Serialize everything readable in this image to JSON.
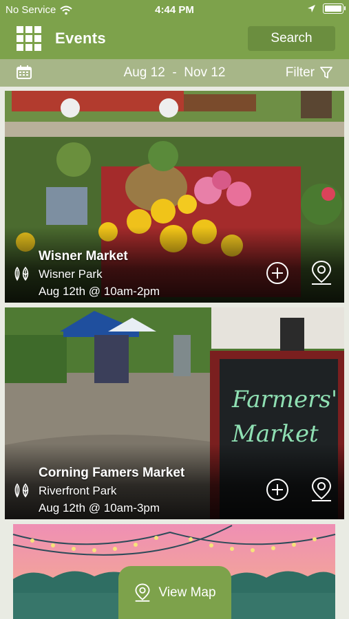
{
  "status_bar": {
    "carrier": "No Service",
    "time": "4:44 PM"
  },
  "header": {
    "title": "Events",
    "search_label": "Search"
  },
  "date_bar": {
    "range": "Aug 12  -  Nov 12",
    "filter_label": "Filter"
  },
  "events": [
    {
      "name": "Wisner Market",
      "venue": "Wisner Park",
      "time": "Aug 12th @ 10am-2pm"
    },
    {
      "name": "Corning Famers Market",
      "venue": "Riverfront Park",
      "time": "Aug 12th @ 10am-3pm"
    }
  ],
  "view_map_label": "View Map",
  "colors": {
    "brand_green": "#7da24b",
    "date_bar": "#a7b688",
    "button_green": "#6b8e3f"
  },
  "icons": [
    "wifi-icon",
    "location-arrow-icon",
    "battery-icon",
    "grid-menu-icon",
    "calendar-icon",
    "filter-icon",
    "market-category-icon",
    "add-circle-icon",
    "map-pin-icon"
  ]
}
